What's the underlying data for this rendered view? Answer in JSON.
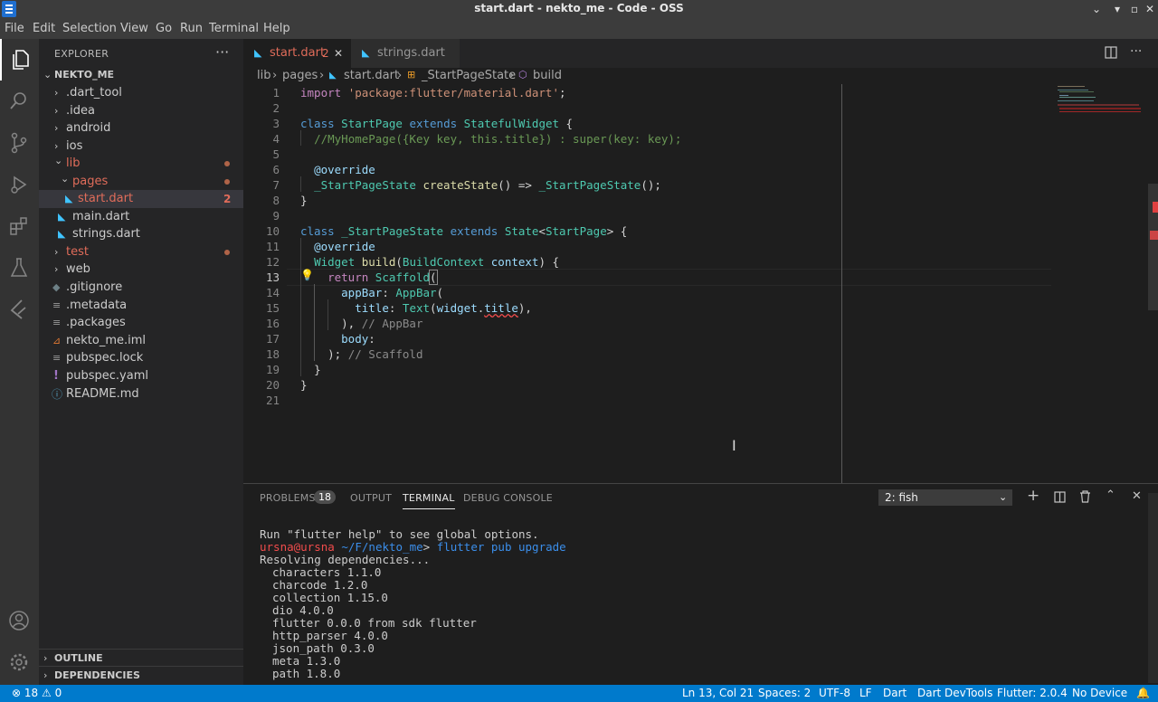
{
  "window": {
    "title": "start.dart - nekto_me - Code - OSS"
  },
  "menu": [
    "File",
    "Edit",
    "Selection",
    "View",
    "Go",
    "Run",
    "Terminal",
    "Help"
  ],
  "explorer": {
    "title": "EXPLORER",
    "more": "···",
    "root": "NEKTO_ME",
    "items": [
      {
        "label": ".dart_tool",
        "chev": "›"
      },
      {
        "label": ".idea",
        "chev": "›"
      },
      {
        "label": "android",
        "chev": "›"
      },
      {
        "label": "ios",
        "chev": "›"
      },
      {
        "label": "lib",
        "chev": "⌄"
      },
      {
        "label": "pages",
        "chev": "⌄"
      },
      {
        "label": "start.dart",
        "badge": "2"
      },
      {
        "label": "main.dart"
      },
      {
        "label": "strings.dart"
      },
      {
        "label": "test",
        "chev": "›"
      },
      {
        "label": "web",
        "chev": "›"
      },
      {
        "label": ".gitignore"
      },
      {
        "label": ".metadata"
      },
      {
        "label": ".packages"
      },
      {
        "label": "nekto_me.iml"
      },
      {
        "label": "pubspec.lock"
      },
      {
        "label": "pubspec.yaml"
      },
      {
        "label": "README.md"
      }
    ],
    "outline": "OUTLINE",
    "dependencies": "DEPENDENCIES"
  },
  "tabs": [
    {
      "label": "start.dart",
      "badge": "2"
    },
    {
      "label": "strings.dart"
    }
  ],
  "breadcrumbs": [
    "lib",
    "pages",
    "start.dart",
    "_StartPageState",
    "build"
  ],
  "editor": {
    "line_numbers": [
      "1",
      "2",
      "3",
      "4",
      "5",
      "6",
      "7",
      "8",
      "9",
      "10",
      "11",
      "12",
      "13",
      "14",
      "15",
      "16",
      "17",
      "18",
      "19",
      "20",
      "21"
    ],
    "code": {
      "l1_kw": "import",
      "l1_str": "'package:flutter/material.dart'",
      "l1_end": ";",
      "l3_kw1": "class",
      "l3_cls": "StartPage",
      "l3_kw2": "extends",
      "l3_cls2": "StatefulWidget",
      "l3_end": " {",
      "l4_cmt": "//MyHomePage({Key key, this.title}) : super(key: key);",
      "l6_ann": "@override",
      "l7_cls": "_StartPageState",
      "l7_fn": "createState",
      "l7_mid": "() => ",
      "l7_cls2": "_StartPageState",
      "l7_end": "();",
      "l8": "}",
      "l10_kw1": "class",
      "l10_cls": "_StartPageState",
      "l10_kw2": "extends",
      "l10_cls2": "State",
      "l10_lt": "<",
      "l10_cls3": "StartPage",
      "l10_end": "> {",
      "l11_ann": "@override",
      "l12_cls": "Widget",
      "l12_fn": "build",
      "l12_p1": "(",
      "l12_cls2": "BuildContext",
      "l12_var": "context",
      "l12_end": ") {",
      "l13_kw": "return",
      "l13_cls": "Scaffold",
      "l13_end": "(",
      "l14_var": "appBar",
      "l14_colon": ": ",
      "l14_cls": "AppBar",
      "l14_end": "(",
      "l15_var": "title",
      "l15_colon": ": ",
      "l15_cls": "Text",
      "l15_p": "(",
      "l15_var2": "widget",
      "l15_dot": ".",
      "l15_var3": "title",
      "l15_end": "),",
      "l16_p": "),",
      "l16_cmt": "// AppBar",
      "l17_var": "body",
      "l17_end": ":",
      "l18_p": ");",
      "l18_cmt": "// Scaffold",
      "l19": "}",
      "l20": "}"
    }
  },
  "panel": {
    "tabs": [
      "PROBLEMS",
      "OUTPUT",
      "TERMINAL",
      "DEBUG CONSOLE"
    ],
    "problems_count": "18",
    "terminal_select": "2: fish",
    "terminal_lines": {
      "l1": "Run \"flutter help\" to see global options.",
      "prompt_user": "ursna@ursna",
      "prompt_path": "~/F/nekto_me",
      "prompt_sym": ">",
      "prompt_cmd": "flutter pub upgrade",
      "l3": "Resolving dependencies...",
      "deps": [
        "characters 1.1.0",
        "charcode 1.2.0",
        "collection 1.15.0",
        "dio 4.0.0",
        "flutter 0.0.0 from sdk flutter",
        "http_parser 4.0.0",
        "json_path 0.3.0",
        "meta 1.3.0",
        "path 1.8.0"
      ]
    }
  },
  "status": {
    "errors": "18",
    "warnings": "0",
    "position": "Ln 13, Col 21",
    "spaces": "Spaces: 2",
    "encoding": "UTF-8",
    "eol": "LF",
    "language": "Dart",
    "devtools": "Dart DevTools",
    "flutter": "Flutter: 2.0.4",
    "device": "No Device"
  },
  "colors": {
    "accent": "#007acc",
    "modified": "#e06c5a"
  }
}
